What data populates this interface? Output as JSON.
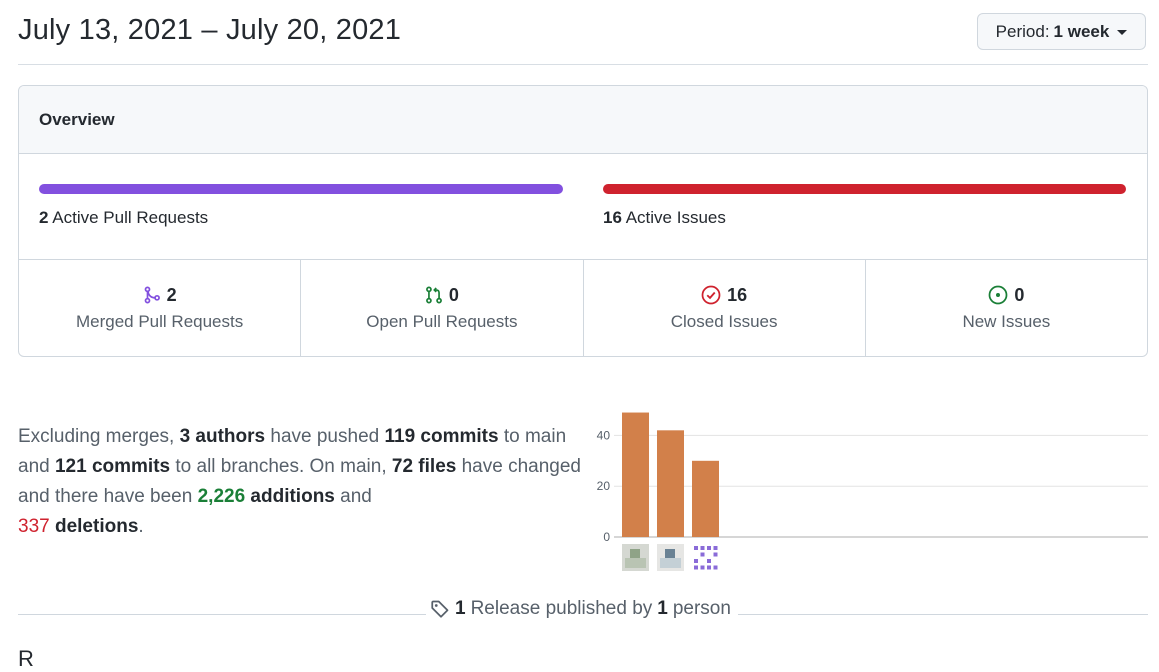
{
  "header": {
    "title": "July 13, 2021 – July 20, 2021",
    "period_prefix": "Period:",
    "period_value": "1 week"
  },
  "overview": {
    "heading": "Overview",
    "active_prs_count": "2",
    "active_prs_label": "Active Pull Requests",
    "active_issues_count": "16",
    "active_issues_label": "Active Issues",
    "colors": {
      "pr_bar": "#8250df",
      "issues_bar": "#cf222e"
    },
    "stats": [
      {
        "count": "2",
        "label": "Merged Pull Requests",
        "icon": "git-merge-icon",
        "color": "#8250df"
      },
      {
        "count": "0",
        "label": "Open Pull Requests",
        "icon": "git-pull-request-icon",
        "color": "#1a7f37"
      },
      {
        "count": "16",
        "label": "Closed Issues",
        "icon": "issue-closed-icon",
        "color": "#cf222e"
      },
      {
        "count": "0",
        "label": "New Issues",
        "icon": "issue-opened-icon",
        "color": "#1a7f37"
      }
    ]
  },
  "summary": {
    "t1": "Excluding merges, ",
    "authors": "3 authors",
    "t2": " have pushed ",
    "commits_main": "119 commits",
    "t3": " to main and ",
    "commits_all": "121 commits",
    "t4": " to all branches. On main, ",
    "files": "72 files",
    "t5": " have changed and there have been ",
    "additions_num": "2,226",
    "additions_word": "additions",
    "t6": " and ",
    "deletions_num": "337",
    "deletions_word": "deletions",
    "t7": "."
  },
  "chart_data": {
    "type": "bar",
    "categories": [
      "author-1",
      "author-2",
      "author-3"
    ],
    "values": [
      49,
      42,
      30
    ],
    "ylim": [
      0,
      50
    ],
    "yticks": [
      "0",
      "20",
      "40"
    ],
    "bar_color": "#d2804a",
    "grid": true,
    "xlabel": "",
    "ylabel": "",
    "title": ""
  },
  "release": {
    "count": "1",
    "t1": "Release published by",
    "people": "1",
    "t2": "person",
    "icon": "tag-icon"
  },
  "next_section_partial": "R"
}
